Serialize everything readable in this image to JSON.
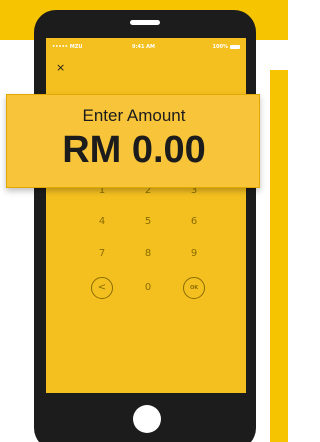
{
  "colors": {
    "accent": "#f6c400",
    "screen": "#f4c020",
    "phone_body": "#1c1c1c",
    "card": "#f8c53a"
  },
  "status_bar": {
    "carrier": "••••• MZU",
    "time": "9:41 AM",
    "battery": "100%"
  },
  "close_icon": "×",
  "amount_card": {
    "label": "Enter Amount",
    "value": "RM 0.00"
  },
  "keypad": {
    "keys": [
      "1",
      "2",
      "3",
      "4",
      "5",
      "6",
      "7",
      "8",
      "9",
      "0"
    ],
    "back_icon": "<",
    "ok_label": "OK"
  }
}
